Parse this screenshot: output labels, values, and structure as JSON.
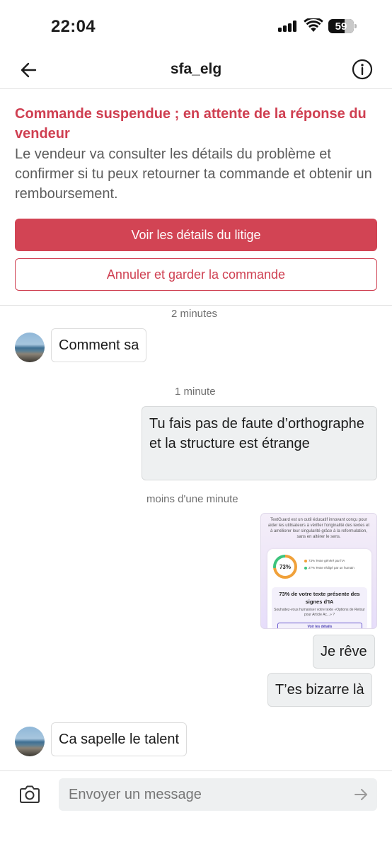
{
  "status_bar": {
    "time": "22:04",
    "battery": "59"
  },
  "header": {
    "title": "sfa_elg",
    "back_icon": "arrow-left-icon",
    "info_icon": "info-circle-icon"
  },
  "alert": {
    "title": "Commande suspendue ; en attente de la réponse du vendeur",
    "body": "Le vendeur va consulter les détails du problème et confirmer si tu peux retourner ta commande et obtenir un remboursement.",
    "primary_button": "Voir les détails du litige",
    "secondary_button": "Annuler et garder la commande",
    "accent_color": "#d24454"
  },
  "messages": [
    {
      "timestamp": "2 minutes"
    },
    {
      "sender": "other",
      "text": "Comment sa"
    },
    {
      "timestamp": "1 minute"
    },
    {
      "sender": "me",
      "text": "Tu fais pas de faute d’orthographe et la structure est étrange"
    },
    {
      "timestamp": "moins d'une minute"
    },
    {
      "sender": "me",
      "type": "image",
      "image": {
        "intro": "TextGuard est un outil éducatif innovant conçu pour aider les utilisateurs à vérifier l'originalité des textes et à améliorer leur singularité grâce à la reformulation, sans en altérer le sens.",
        "percent_label": "73%",
        "ai_percent": 73,
        "legend_ai": "73% Texte généré par l'IA",
        "legend_human": "27% Texte rédigé par un humain",
        "headline": "73% de votre texte présente des signes d'IA",
        "question": "Souhaitez-vous humaniser votre texte «Options de Retour pour Article Ac...» ?",
        "link": "Voir les détails"
      }
    },
    {
      "sender": "me",
      "text": "Je rêve"
    },
    {
      "sender": "me",
      "text": "T’es bizarre là"
    },
    {
      "sender": "other",
      "text": "Ca sapelle le talent"
    }
  ],
  "composer": {
    "placeholder": "Envoyer un message",
    "camera_icon": "camera-icon",
    "send_icon": "send-arrow-icon"
  }
}
